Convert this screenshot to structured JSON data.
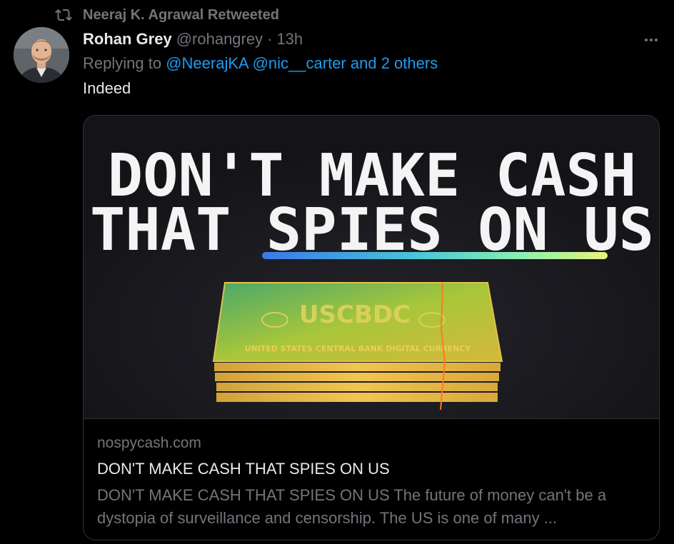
{
  "retweet": {
    "label": "Neeraj K. Agrawal Retweeted",
    "icon": "retweet-icon"
  },
  "tweet": {
    "display_name": "Rohan Grey",
    "handle": "@rohangrey",
    "separator": "·",
    "time": "13h",
    "replying_prefix": "Replying to ",
    "reply_mention_1": "@NeerajKA",
    "reply_mention_2": "@nic__carter",
    "reply_others": "and 2 others",
    "text": "Indeed",
    "more_icon": "more-icon"
  },
  "card": {
    "image_headline_line1": "DON'T MAKE CASH",
    "image_headline_line2_a": "THAT ",
    "image_headline_line2_b": "SPIES ON US",
    "bill_text": "USCBDC",
    "bill_band_text": "UNITED STATES CENTRAL BANK DIGITAL CURRENCY",
    "domain": "nospycash.com",
    "title": "DON'T MAKE CASH THAT SPIES ON US",
    "description": "DON'T MAKE CASH THAT SPIES ON US The future of money can't be a dystopia of surveillance and censorship. The US is one of many ..."
  },
  "colors": {
    "background": "#000000",
    "text_primary": "#e7e9ea",
    "text_secondary": "#71767b",
    "link": "#1d9bf0",
    "border": "#2f3336"
  }
}
